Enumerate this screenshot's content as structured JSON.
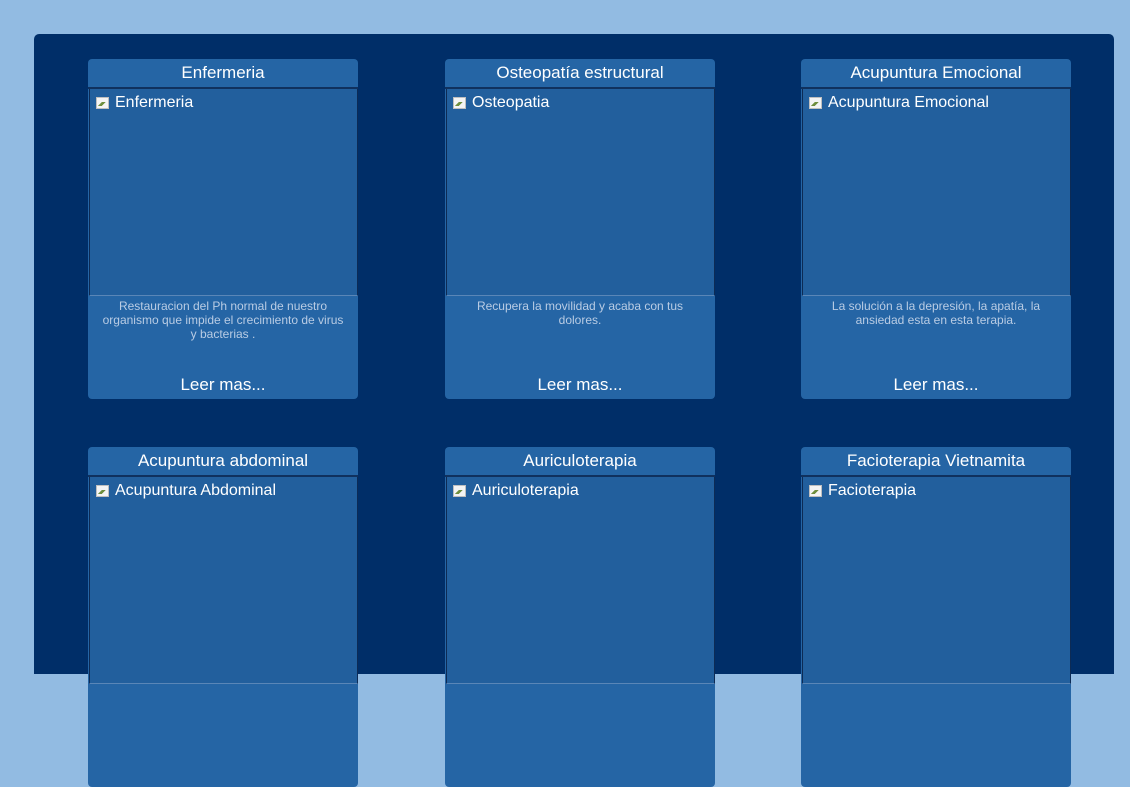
{
  "cards": [
    {
      "title": "Enfermeria",
      "image_alt": "Enfermeria",
      "description": "Restauracion del Ph normal de nuestro organismo que impide el crecimiento de virus y bacterias .",
      "more": "Leer mas..."
    },
    {
      "title": "Osteopatía estructural",
      "image_alt": "Osteopatia",
      "description": "Recupera la movilidad y acaba con tus dolores.",
      "more": "Leer mas..."
    },
    {
      "title": "Acupuntura Emocional",
      "image_alt": "Acupuntura Emocional",
      "description": "La solución a la depresión, la apatía, la ansiedad esta en esta terapia.",
      "more": "Leer mas..."
    },
    {
      "title": "Acupuntura abdominal",
      "image_alt": "Acupuntura Abdominal",
      "description": "",
      "more": ""
    },
    {
      "title": "Auriculoterapia",
      "image_alt": "Auriculoterapia",
      "description": "",
      "more": ""
    },
    {
      "title": "Facioterapia Vietnamita",
      "image_alt": "Facioterapia",
      "description": "",
      "more": ""
    }
  ],
  "colors": {
    "page_background": "#92bbe2",
    "panel_background": "#002e68",
    "card_background": "#2565a5",
    "description_text": "#b9cce4"
  },
  "icons": {
    "broken_image": "broken-image-icon"
  }
}
